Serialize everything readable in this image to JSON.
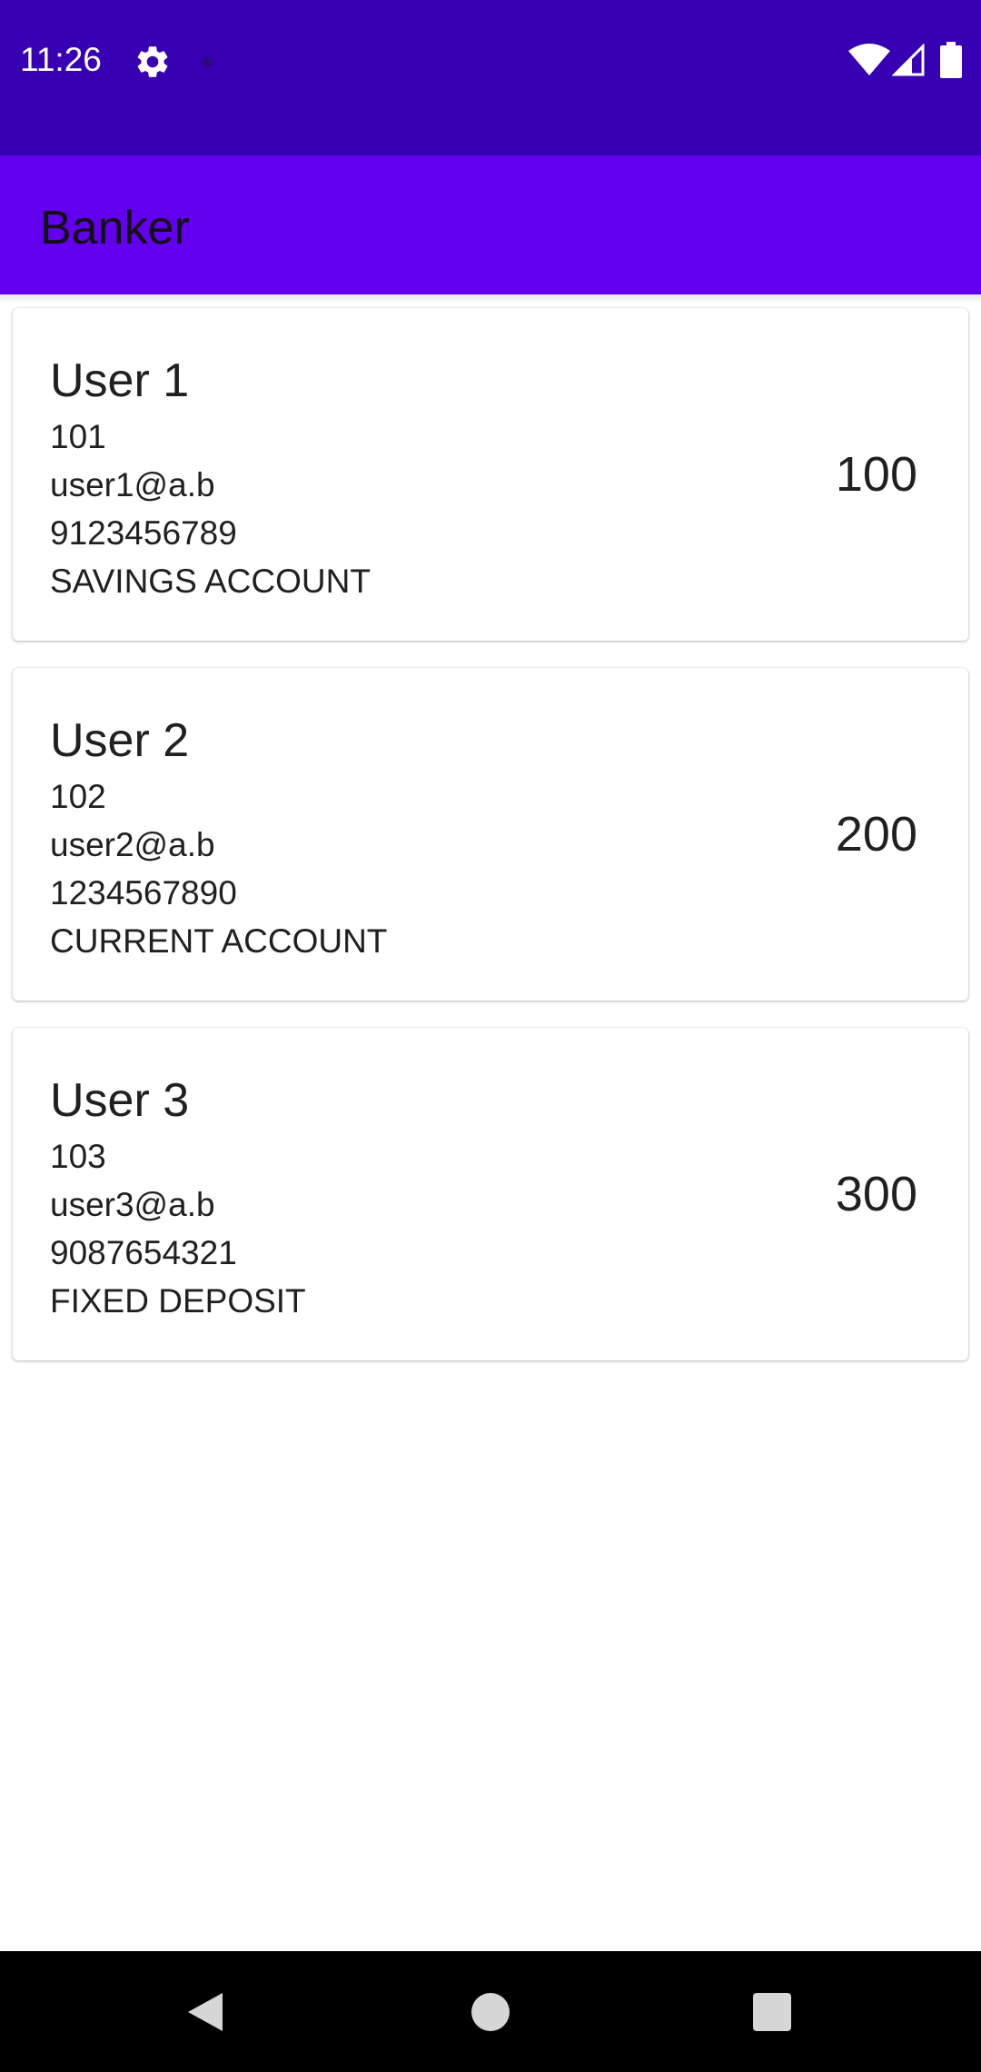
{
  "status_bar": {
    "time": "11:26",
    "icons": [
      "gear-icon",
      "notification-dot-icon",
      "wifi-icon",
      "signal-icon",
      "battery-icon"
    ]
  },
  "app_bar": {
    "title": "Banker"
  },
  "accounts": [
    {
      "name": "User 1",
      "id": "101",
      "email": "user1@a.b",
      "phone": "9123456789",
      "type": "SAVINGS ACCOUNT",
      "amount": "100"
    },
    {
      "name": "User 2",
      "id": "102",
      "email": "user2@a.b",
      "phone": "1234567890",
      "type": "CURRENT ACCOUNT",
      "amount": "200"
    },
    {
      "name": "User 3",
      "id": "103",
      "email": "user3@a.b",
      "phone": "9087654321",
      "type": "FIXED DEPOSIT",
      "amount": "300"
    }
  ],
  "nav_bar": {
    "icons": [
      "back-icon",
      "home-icon",
      "recents-icon"
    ]
  },
  "colors": {
    "status_bar": "#3700B3",
    "app_bar": "#6200EE",
    "nav_bar": "#000000"
  }
}
